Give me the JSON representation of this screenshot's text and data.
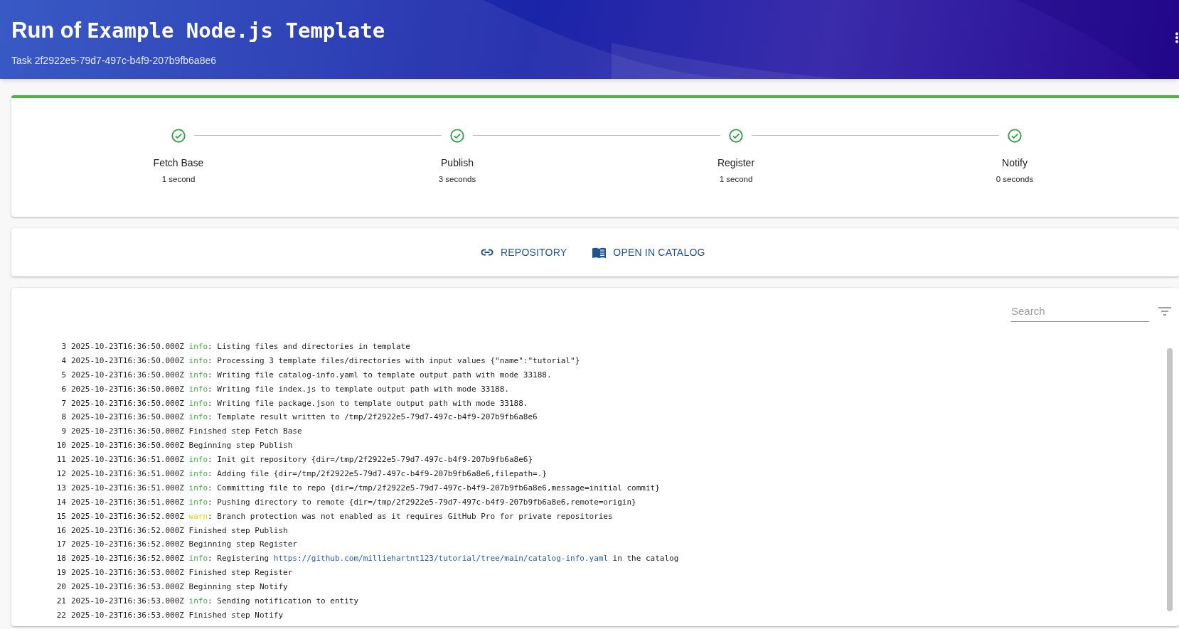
{
  "header": {
    "title_prefix": "Run of",
    "title_name": "Example Node.js Template",
    "subtitle": "Task 2f2922e5-79d7-497c-b4f9-207b9fb6a8e6"
  },
  "steps": [
    {
      "label": "Fetch Base",
      "duration": "1 second",
      "completed": true
    },
    {
      "label": "Publish",
      "duration": "3 seconds",
      "completed": true
    },
    {
      "label": "Register",
      "duration": "1 second",
      "completed": true
    },
    {
      "label": "Notify",
      "duration": "0 seconds",
      "completed": true
    }
  ],
  "links": [
    {
      "kind": "link",
      "label": "REPOSITORY"
    },
    {
      "kind": "catalog",
      "label": "OPEN IN CATALOG"
    }
  ],
  "log": {
    "search": {
      "placeholder": "Search"
    },
    "lines": [
      {
        "number": "3",
        "timestamp": "2025-10-23T16:36:50.000Z",
        "level": "info",
        "segments": [
          {
            "kind": "text",
            "text": ": Listing files and directories in template"
          }
        ]
      },
      {
        "number": "4",
        "timestamp": "2025-10-23T16:36:50.000Z",
        "level": "info",
        "segments": [
          {
            "kind": "text",
            "text": ": Processing 3 template files/directories with input values {\"name\":\"tutorial\"}"
          }
        ]
      },
      {
        "number": "5",
        "timestamp": "2025-10-23T16:36:50.000Z",
        "level": "info",
        "segments": [
          {
            "kind": "text",
            "text": ": Writing file catalog-info.yaml to template output path with mode 33188."
          }
        ]
      },
      {
        "number": "6",
        "timestamp": "2025-10-23T16:36:50.000Z",
        "level": "info",
        "segments": [
          {
            "kind": "text",
            "text": ": Writing file index.js to template output path with mode 33188."
          }
        ]
      },
      {
        "number": "7",
        "timestamp": "2025-10-23T16:36:50.000Z",
        "level": "info",
        "segments": [
          {
            "kind": "text",
            "text": ": Writing file package.json to template output path with mode 33188."
          }
        ]
      },
      {
        "number": "8",
        "timestamp": "2025-10-23T16:36:50.000Z",
        "level": "info",
        "segments": [
          {
            "kind": "text",
            "text": ": Template result written to /tmp/2f2922e5-79d7-497c-b4f9-207b9fb6a8e6"
          }
        ]
      },
      {
        "number": "9",
        "timestamp": "2025-10-23T16:36:50.000Z",
        "segments": [
          {
            "kind": "text",
            "text": "Finished step Fetch Base"
          }
        ]
      },
      {
        "number": "10",
        "timestamp": "2025-10-23T16:36:50.000Z",
        "segments": [
          {
            "kind": "text",
            "text": "Beginning step Publish"
          }
        ]
      },
      {
        "number": "11",
        "timestamp": "2025-10-23T16:36:51.000Z",
        "level": "info",
        "segments": [
          {
            "kind": "text",
            "text": ": Init git repository {dir=/tmp/2f2922e5-79d7-497c-b4f9-207b9fb6a8e6}"
          }
        ]
      },
      {
        "number": "12",
        "timestamp": "2025-10-23T16:36:51.000Z",
        "level": "info",
        "segments": [
          {
            "kind": "text",
            "text": ": Adding file {dir=/tmp/2f2922e5-79d7-497c-b4f9-207b9fb6a8e6,filepath=.}"
          }
        ]
      },
      {
        "number": "13",
        "timestamp": "2025-10-23T16:36:51.000Z",
        "level": "info",
        "segments": [
          {
            "kind": "text",
            "text": ": Committing file to repo {dir=/tmp/2f2922e5-79d7-497c-b4f9-207b9fb6a8e6,message=initial commit}"
          }
        ]
      },
      {
        "number": "14",
        "timestamp": "2025-10-23T16:36:51.000Z",
        "level": "info",
        "segments": [
          {
            "kind": "text",
            "text": ": Pushing directory to remote {dir=/tmp/2f2922e5-79d7-497c-b4f9-207b9fb6a8e6,remote=origin}"
          }
        ]
      },
      {
        "number": "15",
        "timestamp": "2025-10-23T16:36:52.000Z",
        "level": "warn",
        "segments": [
          {
            "kind": "text",
            "text": ": Branch protection was not enabled as it requires GitHub Pro for private repositories"
          }
        ]
      },
      {
        "number": "16",
        "timestamp": "2025-10-23T16:36:52.000Z",
        "segments": [
          {
            "kind": "text",
            "text": "Finished step Publish"
          }
        ]
      },
      {
        "number": "17",
        "timestamp": "2025-10-23T16:36:52.000Z",
        "segments": [
          {
            "kind": "text",
            "text": "Beginning step Register"
          }
        ]
      },
      {
        "number": "18",
        "timestamp": "2025-10-23T16:36:52.000Z",
        "level": "info",
        "segments": [
          {
            "kind": "text",
            "text": ": Registering "
          },
          {
            "kind": "link",
            "text": "https://github.com/milliehartnt123/tutorial/tree/main/catalog-info.yaml"
          },
          {
            "kind": "text",
            "text": " in the catalog"
          }
        ]
      },
      {
        "number": "19",
        "timestamp": "2025-10-23T16:36:53.000Z",
        "segments": [
          {
            "kind": "text",
            "text": "Finished step Register"
          }
        ]
      },
      {
        "number": "20",
        "timestamp": "2025-10-23T16:36:53.000Z",
        "segments": [
          {
            "kind": "text",
            "text": "Beginning step Notify"
          }
        ]
      },
      {
        "number": "21",
        "timestamp": "2025-10-23T16:36:53.000Z",
        "level": "info",
        "segments": [
          {
            "kind": "text",
            "text": ": Sending notification to entity"
          }
        ]
      },
      {
        "number": "22",
        "timestamp": "2025-10-23T16:36:53.000Z",
        "segments": [
          {
            "kind": "text",
            "text": "Finished step Notify"
          }
        ]
      }
    ]
  }
}
